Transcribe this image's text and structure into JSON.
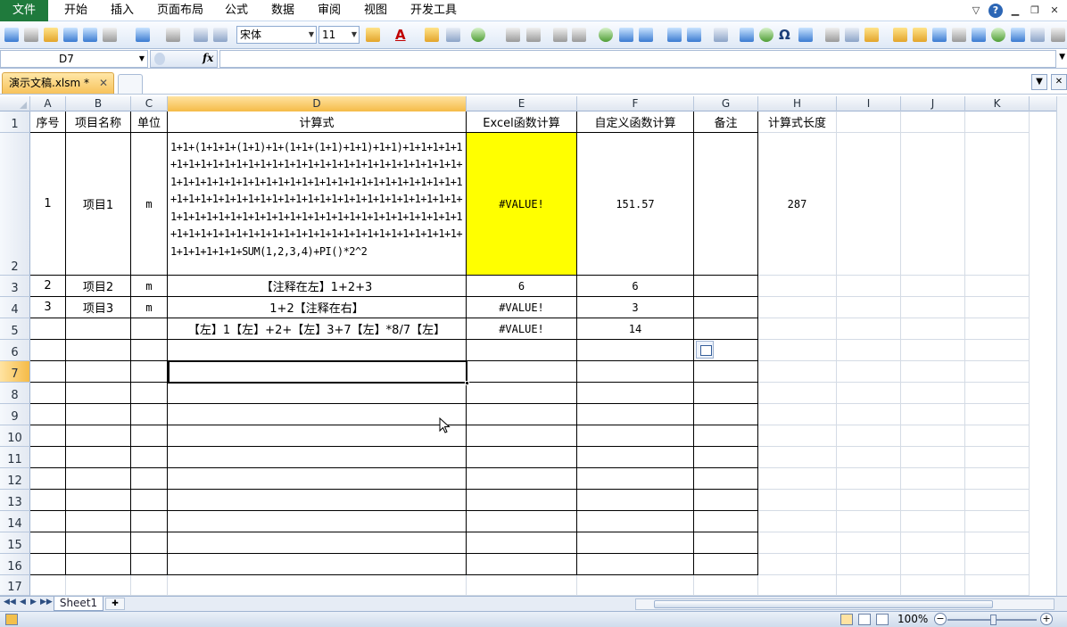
{
  "menu": {
    "file": "文件",
    "items": [
      "开始",
      "插入",
      "页面布局",
      "公式",
      "数据",
      "审阅",
      "视图",
      "开发工具"
    ]
  },
  "toolbar": {
    "font_name": "宋体",
    "font_size": "11",
    "omega": "Ω"
  },
  "formula_bar": {
    "name_box": "D7",
    "fx": "fx",
    "content": ""
  },
  "workbook": {
    "active_tab": "演示文稿.xlsm *",
    "close": "✕"
  },
  "columns": [
    "A",
    "B",
    "C",
    "D",
    "E",
    "F",
    "G",
    "H",
    "I",
    "J",
    "K"
  ],
  "rows": [
    "1",
    "2",
    "3",
    "4",
    "5",
    "6",
    "7",
    "8",
    "9",
    "10",
    "11",
    "12",
    "13",
    "14",
    "15",
    "16",
    "17"
  ],
  "cells": {
    "A1": "序号",
    "B1": "项目名称",
    "C1": "单位",
    "D1": "计算式",
    "E1": "Excel函数计算",
    "F1": "自定义函数计算",
    "G1": "备注",
    "H1": "计算式长度",
    "A2": "1",
    "B2": "项目1",
    "C2": "m",
    "D2": "1+1+(1+1+1+(1+1)+1+(1+1+(1+1)+1+1)+1+1)+1+1+1+1+1+1+1+1+1+1+1+1+1+1+1+1+1+1+1+1+1+1+1+1+1+1+1+1+1+1+1+1+1+1+1+1+1+1+1+1+1+1+1+1+1+1+1+1+1+1+1+1+1+1+1+1+1+1+1+1+1+1+1+1+1+1+1+1+1+1+1+1+1+1+1+1+1+1+1+1+1+1+1+1+1+1+1+1+1+1+1+1+1+1+1+1+1+1+1+1+1+1+1+1+1+1+1+1+1+1+1+1+1+1+1+1+1+1+1+1+1+1+1+1+1+1+1+1+1+1+1+1+1+SUM(1,2,3,4)+PI()*2^2",
    "E2": "#VALUE!",
    "F2": "151.57",
    "H2": "287",
    "A3": "2",
    "B3": "项目2",
    "C3": "m",
    "D3": "【注释在左】1+2+3",
    "E3": "6",
    "F3": "6",
    "A4": "3",
    "B4": "项目3",
    "C4": "m",
    "D4": "1+2【注释在右】",
    "E4": "#VALUE!",
    "F4": "3",
    "D5": "【左】1【左】+2+【左】3+7【左】*8/7【左】",
    "E5": "#VALUE!",
    "F5": "14"
  },
  "sheets": [
    "Sheet1"
  ],
  "status": {
    "zoom": "100%"
  },
  "colors": {
    "highlight": "#ffff00",
    "file_tab": "#1f7a3c",
    "selected_header": "#f5bb47"
  }
}
